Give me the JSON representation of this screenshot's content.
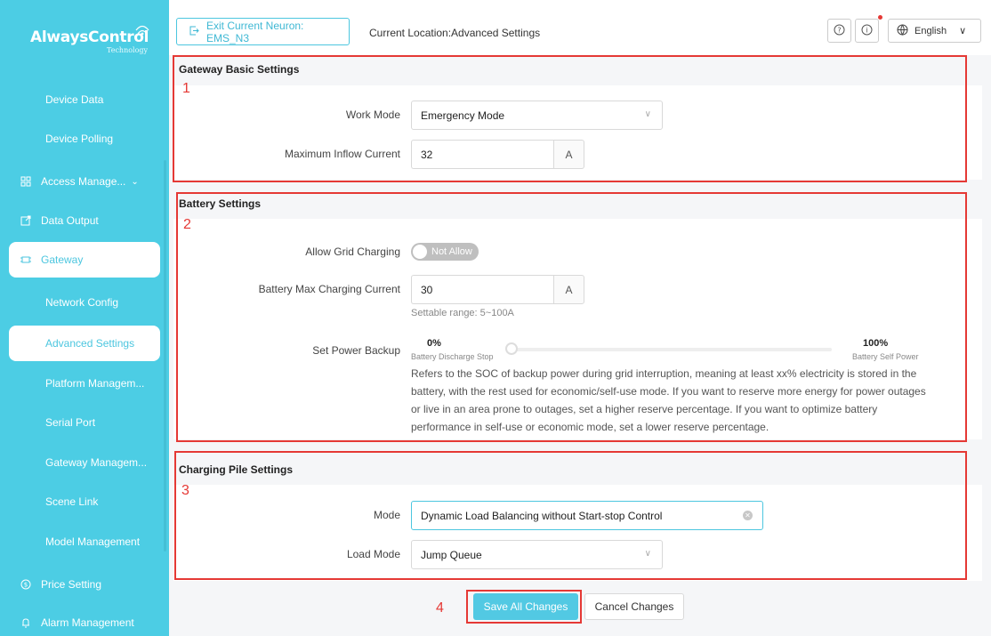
{
  "brand": {
    "name": "AlwaysControl",
    "sub": "Technology"
  },
  "sidebar": {
    "items": [
      {
        "label": "Device Data"
      },
      {
        "label": "Device Polling"
      },
      {
        "label": "Access Manage...",
        "icon": "access-icon"
      },
      {
        "label": "Data Output",
        "icon": "export-icon"
      },
      {
        "label": "Gateway",
        "icon": "gateway-icon"
      },
      {
        "label": "Network Config"
      },
      {
        "label": "Advanced Settings"
      },
      {
        "label": "Platform Managem..."
      },
      {
        "label": "Serial Port"
      },
      {
        "label": "Gateway Managem..."
      },
      {
        "label": "Scene Link"
      },
      {
        "label": "Model Management"
      },
      {
        "label": "Price Setting",
        "icon": "price-icon"
      },
      {
        "label": "Alarm Management",
        "icon": "alarm-icon"
      }
    ]
  },
  "topbar": {
    "exit_label": "Exit Current Neuron: EMS_N3",
    "location": "Current Location:Advanced Settings",
    "language": "English"
  },
  "gateway_basic": {
    "title": "Gateway Basic Settings",
    "work_mode_label": "Work Mode",
    "work_mode_value": "Emergency Mode",
    "max_inflow_label": "Maximum Inflow Current",
    "max_inflow_value": "32",
    "max_inflow_unit": "A"
  },
  "battery": {
    "title": "Battery Settings",
    "grid_charging_label": "Allow Grid Charging",
    "grid_charging_value": "Not Allow",
    "max_charging_label": "Battery Max Charging Current",
    "max_charging_value": "30",
    "max_charging_unit": "A",
    "max_charging_hint": "Settable range: 5~100A",
    "power_backup_label": "Set Power Backup",
    "min_pct": "0%",
    "min_caption": "Battery Discharge Stop",
    "max_pct": "100%",
    "max_caption": "Battery Self Power",
    "backup_level_fraction": 0,
    "description": "Refers to the SOC of backup power during grid interruption, meaning at least xx% electricity is stored in the battery, with the rest used for economic/self-use mode. If you want to reserve more energy for power outages or live in an area prone to outages, set a higher reserve percentage. If you want to optimize battery performance in self-use or economic mode, set a lower reserve percentage."
  },
  "charging_pile": {
    "title": "Charging Pile Settings",
    "mode_label": "Mode",
    "mode_value": "Dynamic Load Balancing without Start-stop Control",
    "load_mode_label": "Load Mode",
    "load_mode_value": "Jump Queue"
  },
  "actions": {
    "save_label": "Save All Changes",
    "cancel_label": "Cancel Changes"
  },
  "annotations": [
    "1",
    "2",
    "3",
    "4"
  ],
  "colors": {
    "sidebar": "#4ccde4",
    "accent": "#4cc6df",
    "highlight": "#e53935"
  }
}
